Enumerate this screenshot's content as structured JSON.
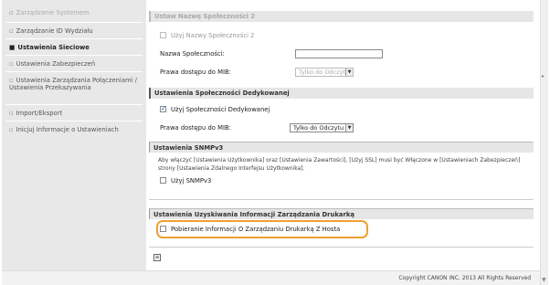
{
  "sidebar": {
    "items": [
      {
        "label": "Zarządzanie Systemem"
      },
      {
        "label": "Zarządzanie ID Wydziału"
      },
      {
        "label": "Ustawienia Sieciowe"
      },
      {
        "label": "Ustawienia Zabezpieczeń"
      },
      {
        "label": "Ustawienia Zarządzania Połączeniami / Ustawienia Przekazywania"
      },
      {
        "label": "Import/Eksport"
      },
      {
        "label": "Inicjuj Informacje o Ustawieniach"
      }
    ]
  },
  "main": {
    "top_header": "Ustaw Nazwę Społeczności 2",
    "top_checkbox_label": "Użyj Nazwy Społeczności 2",
    "community_name_label": "Nazwa Społeczności:",
    "mib_access_label": "Prawa dostępu do MIB:",
    "mib_access_value_faded": "Tylko do Odczytu",
    "dedicated_header": "Ustawienia Społeczności Dedykowanej",
    "dedicated_checkbox_label": "Użyj Społeczności Dedykowanej",
    "dedicated_mib_label": "Prawa dostępu do MIB:",
    "dedicated_mib_value": "Tylko do Odczytu",
    "snmpv3_header": "Ustawienia SNMPv3",
    "snmpv3_desc": "Aby włączyć [Ustawienia Użytkownika] oraz [Ustawienia Zawartości], [Użyj SSL] musi być Włączone w [Ustawieniach Zabezpieczeń] strony [Ustawienia Zdalnego Interfejsu Użytkownika].",
    "snmpv3_checkbox_label": "Użyj SNMPv3",
    "printer_header": "Ustawienia Uzyskiwania Informacji Zarządzania Drukarką",
    "printer_checkbox_label": "Pobieranie Informacji O Zarządzaniu Drukarką Z Hosta",
    "dropdown_glyph": "▼",
    "bottom_icon_glyph": "≡"
  },
  "footer": {
    "copyright": "Copyright CANON INC. 2013 All Rights Reserved"
  },
  "colors": {
    "highlight": "#f0a030",
    "sidebar_bg": "#e8e8e8",
    "section_bg": "#e6e6e6"
  }
}
